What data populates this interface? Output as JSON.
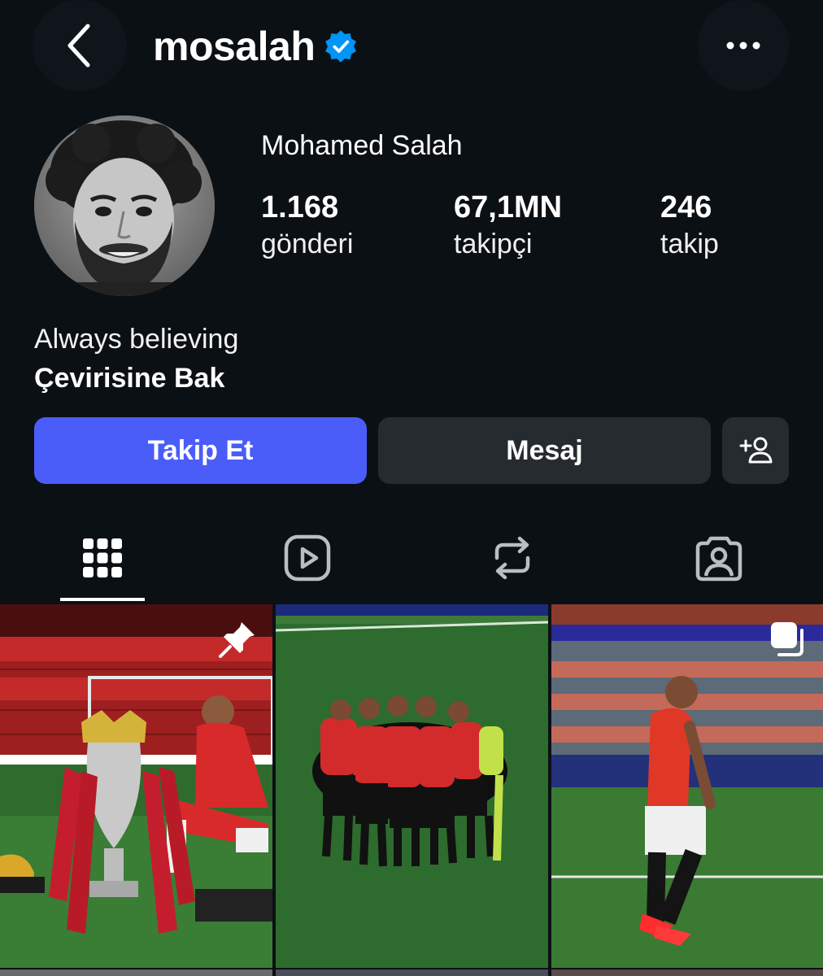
{
  "header": {
    "username": "mosalah",
    "verified": true,
    "back_icon": "chevron-left-icon",
    "more_icon": "more-horizontal-icon"
  },
  "profile": {
    "full_name": "Mohamed Salah",
    "stats": [
      {
        "value": "1.168",
        "label": "gönderi"
      },
      {
        "value": "67,1MN",
        "label": "takipçi"
      },
      {
        "value": "246",
        "label": "takip"
      }
    ],
    "bio": "Always believing",
    "translate_link": "Çevirisine Bak"
  },
  "actions": {
    "follow_label": "Takip Et",
    "message_label": "Mesaj",
    "add_icon": "person-add-icon"
  },
  "tabs": [
    {
      "icon": "grid-icon",
      "active": true
    },
    {
      "icon": "reels-icon",
      "active": false
    },
    {
      "icon": "repost-icon",
      "active": false
    },
    {
      "icon": "tagged-person-icon",
      "active": false
    }
  ],
  "posts": [
    {
      "badge": "pin-icon"
    },
    {
      "badge": ""
    },
    {
      "badge": "carousel-icon"
    }
  ],
  "colors": {
    "background": "#0b1014",
    "follow_button": "#4a5df9",
    "secondary_button": "#262b30",
    "verified_badge": "#0095f6"
  }
}
